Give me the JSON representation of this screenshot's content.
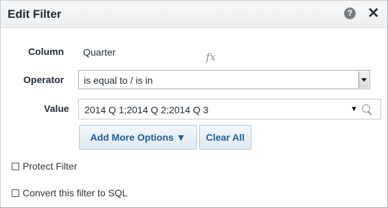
{
  "dialog": {
    "title": "Edit Filter",
    "help_glyph": "?",
    "close_glyph": "✕"
  },
  "form": {
    "column_label": "Column",
    "column_value": "Quarter",
    "fx_label": "fx",
    "operator_label": "Operator",
    "operator_value": "is equal to / is in",
    "value_label": "Value",
    "value_text": "2014 Q 1;2014 Q 2;2014 Q 3",
    "value_dropdown_glyph": "▼"
  },
  "buttons": {
    "add_more_options": "Add More Options ▼",
    "clear_all": "Clear All"
  },
  "options": {
    "protect_filter": "Protect Filter",
    "convert_to_sql": "Convert this filter to SQL"
  },
  "colors": {
    "button_text": "#1d5d99",
    "title_text": "#1f2a35"
  },
  "icons": [
    "help-icon",
    "close-icon",
    "fx-icon",
    "dropdown-arrow-icon",
    "search-icon"
  ]
}
